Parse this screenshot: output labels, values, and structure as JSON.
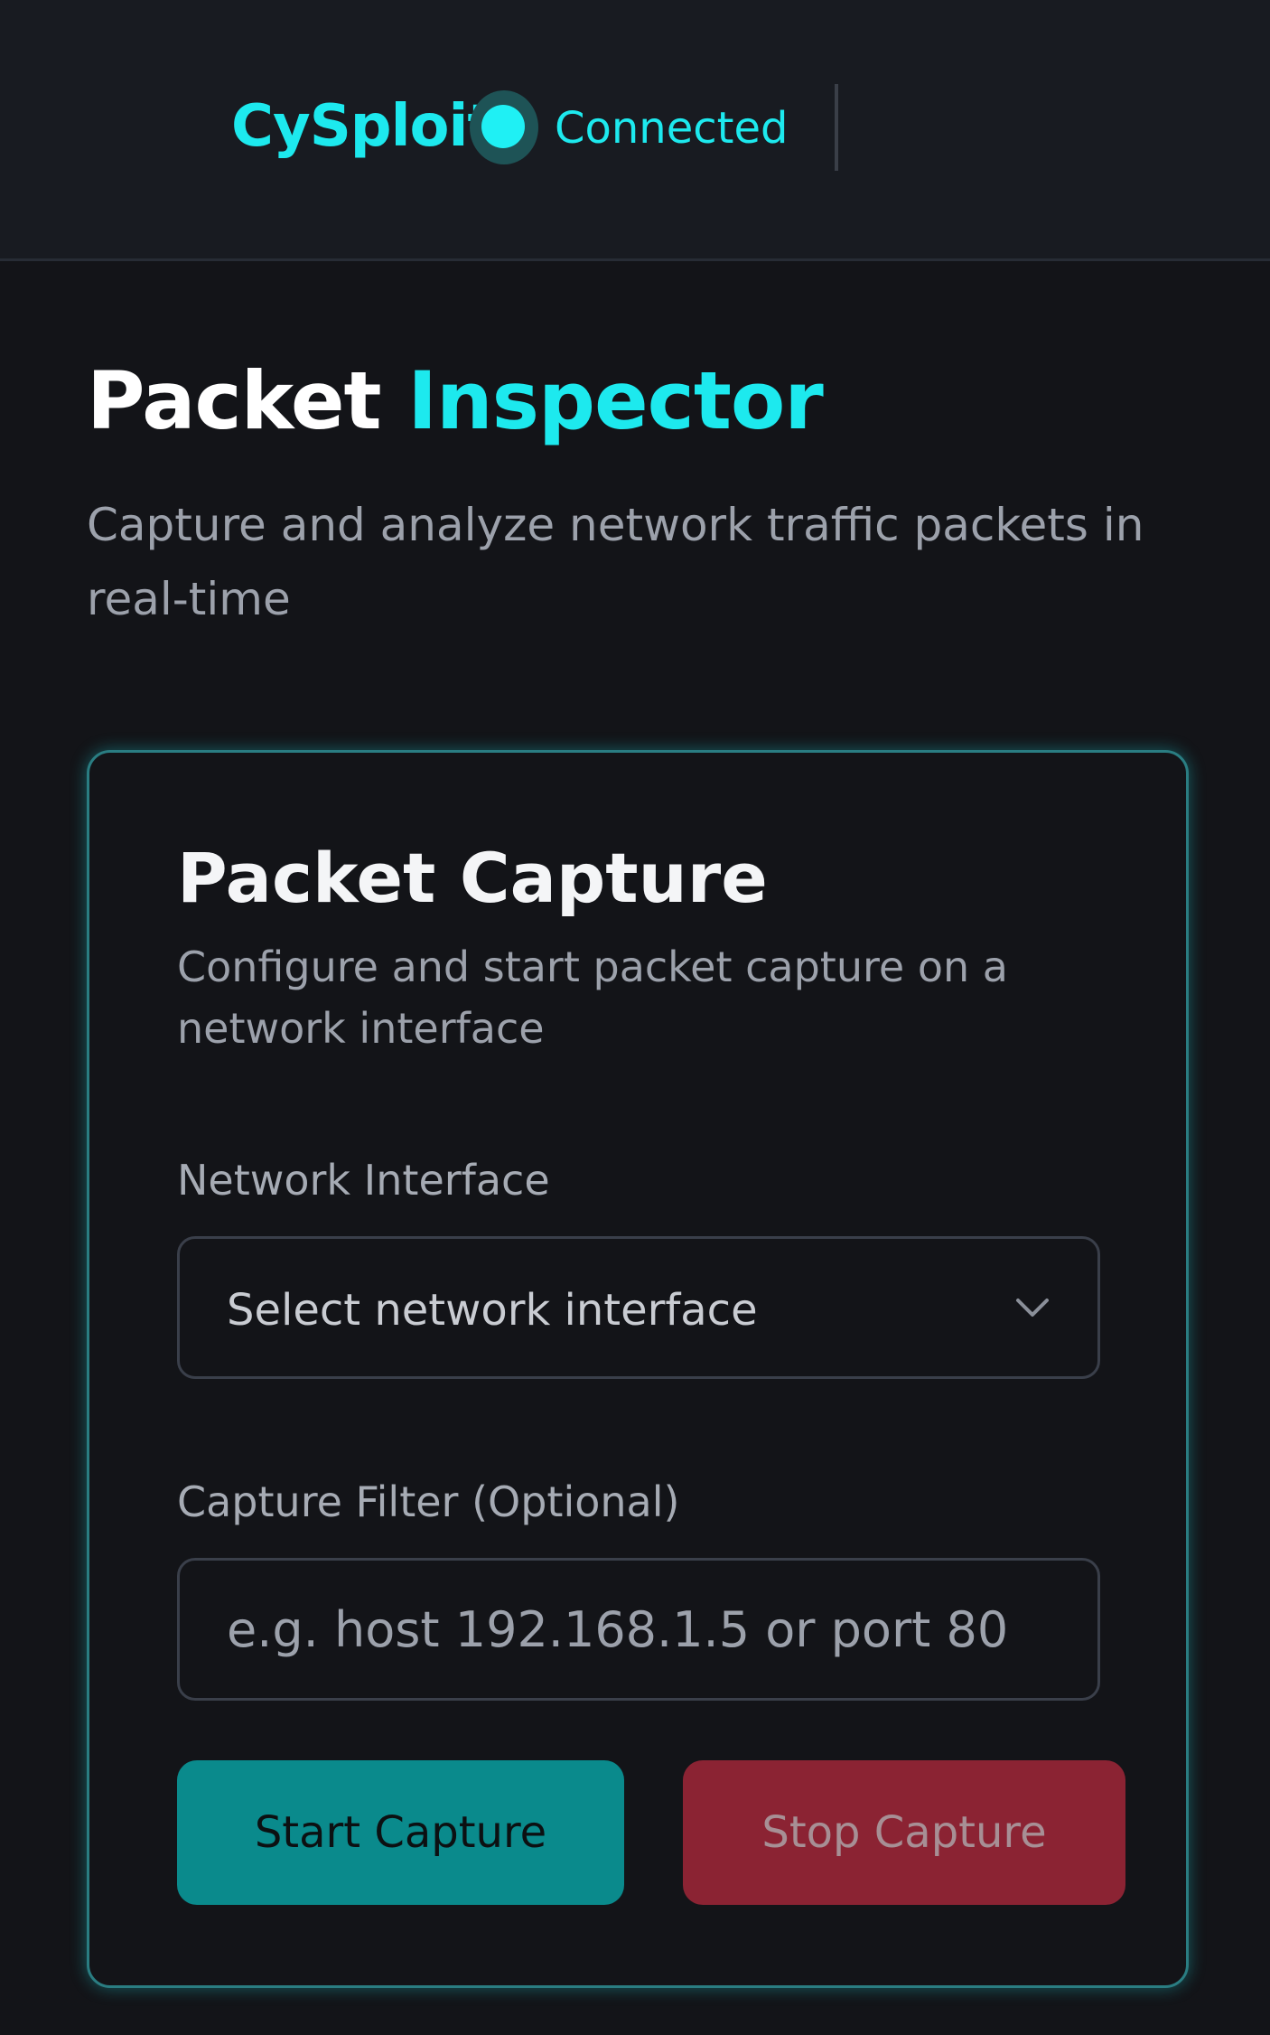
{
  "app": {
    "name": "CySploit",
    "status_text": "Connected",
    "accent_color": "#1de9ee"
  },
  "page": {
    "title_main": "Packet",
    "title_accent": "Inspector",
    "subtitle": "Capture and analyze network traffic packets in real-time"
  },
  "capture_card": {
    "title": "Packet Capture",
    "description": "Configure and start packet capture on a network interface",
    "interface_label": "Network Interface",
    "interface_value": "Select network interface",
    "filter_label": "Capture Filter (Optional)",
    "filter_placeholder": "e.g. host 192.168.1.5 or port 80",
    "start_label": "Start Capture",
    "stop_label": "Stop Capture",
    "start_color": "#0a8a8c",
    "stop_color": "#8b2333"
  }
}
